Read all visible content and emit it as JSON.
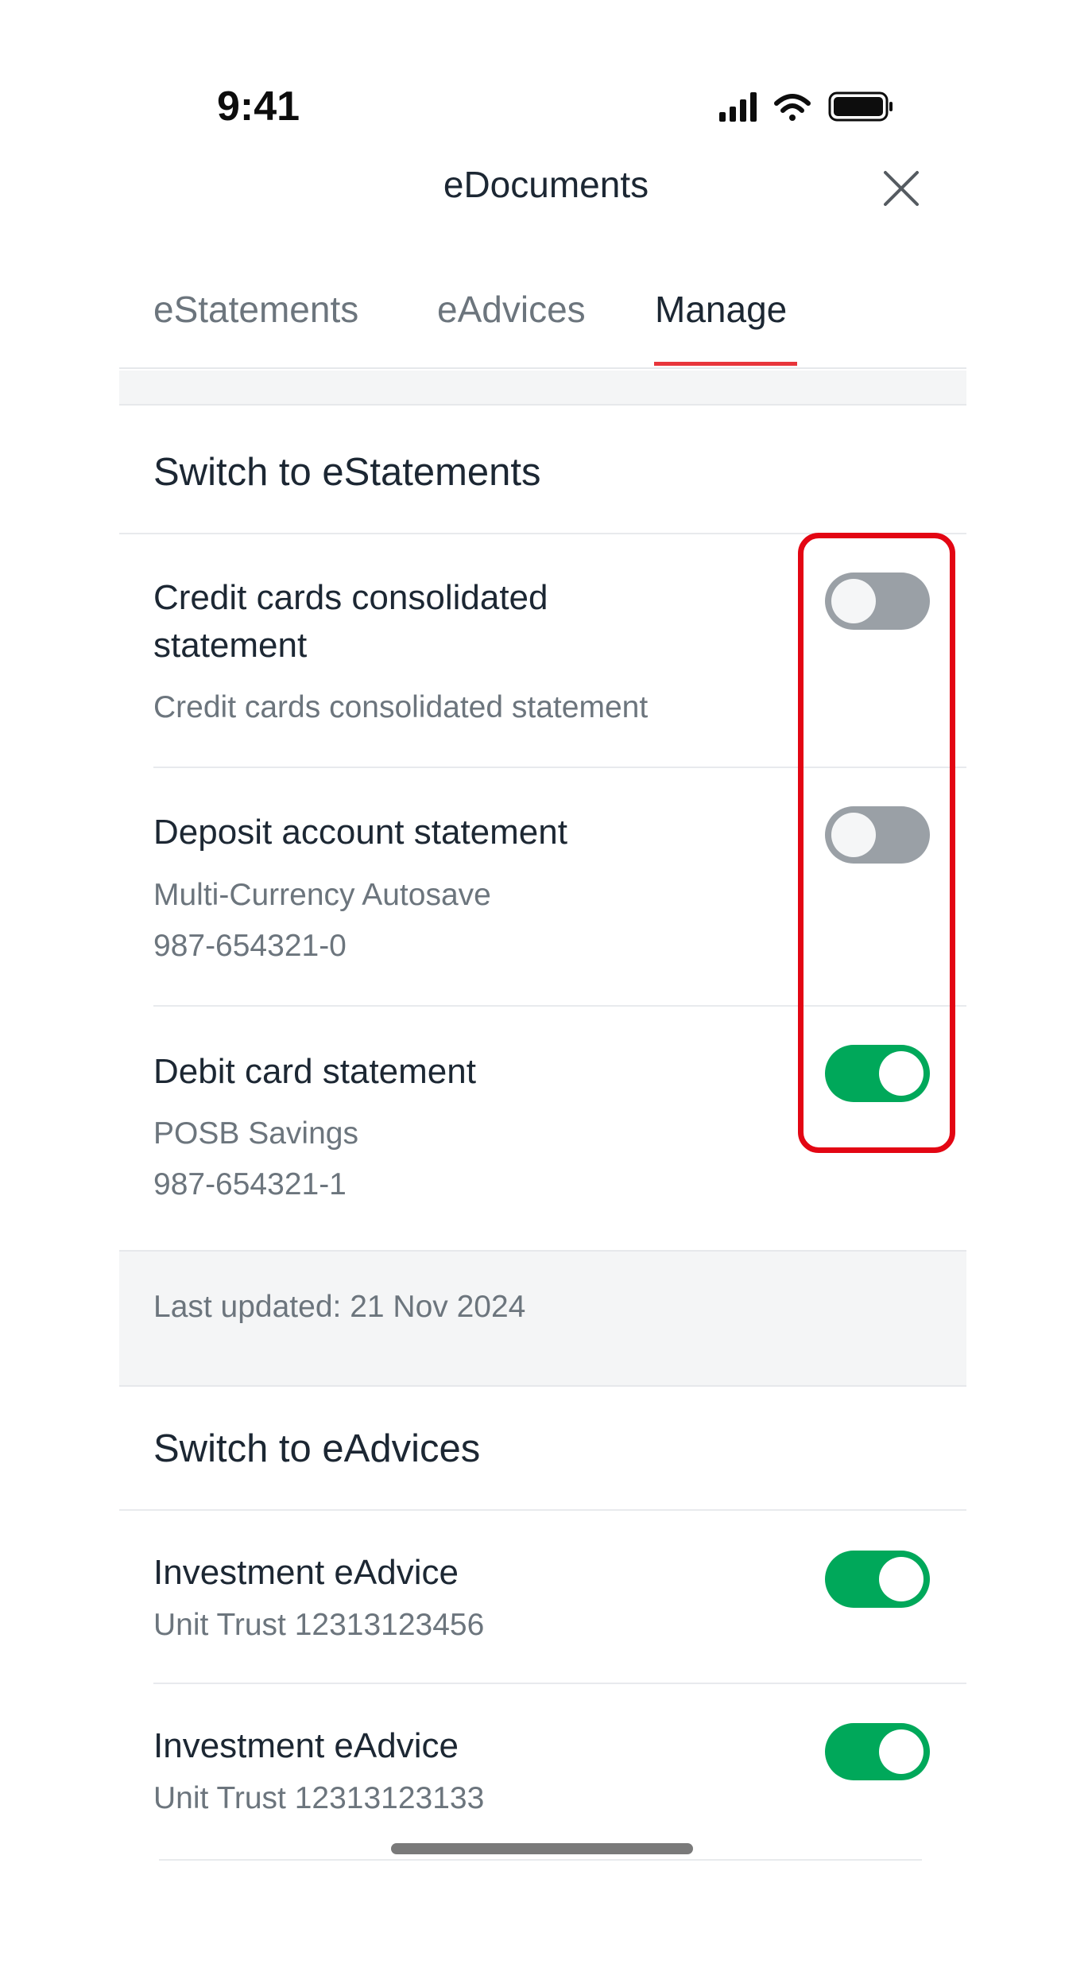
{
  "status_bar": {
    "time": "9:41",
    "icons": [
      "cellular-signal-icon",
      "wifi-icon",
      "battery-icon"
    ]
  },
  "header": {
    "title": "eDocuments",
    "close_icon": "close-icon"
  },
  "tabs": [
    {
      "label": "eStatements",
      "active": false
    },
    {
      "label": "eAdvices",
      "active": false
    },
    {
      "label": "Manage",
      "active": true
    }
  ],
  "estatements": {
    "title": "Switch to eStatements",
    "items": [
      {
        "title": "Credit cards consolidated statement",
        "lines": [
          "Credit cards consolidated statement"
        ],
        "enabled": false
      },
      {
        "title": "Deposit account statement",
        "lines": [
          "Multi-Currency Autosave",
          "987-654321-0"
        ],
        "enabled": false
      },
      {
        "title": "Debit card statement",
        "lines": [
          "POSB Savings",
          "987-654321-1"
        ],
        "enabled": true
      }
    ],
    "last_updated": "Last updated: 21 Nov 2024"
  },
  "eadvices": {
    "title": "Switch to eAdvices",
    "items": [
      {
        "title": "Investment eAdvice",
        "lines": [
          "Unit Trust 12313123456"
        ],
        "enabled": true
      },
      {
        "title": "Investment eAdvice",
        "lines": [
          "Unit Trust 12313123133"
        ],
        "enabled": true
      }
    ]
  },
  "colors": {
    "accent_red": "#e8353b",
    "toggle_on": "#00a85a",
    "toggle_off": "#9aa0a6",
    "highlight": "#e30613"
  }
}
